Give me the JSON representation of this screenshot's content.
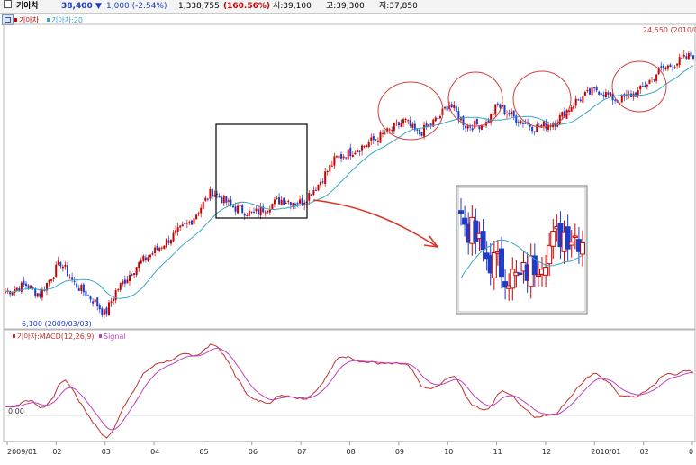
{
  "header": {
    "checkbox_icon": "checkbox-icon",
    "stock_name": "기아차",
    "price": "38,400",
    "change_arrow": "▼",
    "change": "1,000 (-2.54%)",
    "volume": "1,338,755",
    "volume_change": "(160.56%)",
    "open": "시:39,100",
    "high": "고:39,300",
    "low": "저:37,850",
    "colors": {
      "up": "#cc0000",
      "down": "#1e3cc8",
      "text": "#000000"
    }
  },
  "price_panel": {
    "legend_price": "기아차",
    "legend_ma": "기아차:20",
    "high_label": "24,550 (2010/0",
    "low_label": "6,100 (2009/03/03)",
    "settings_icon": "settings-icon",
    "annotation_arrow_color": "#e03020",
    "ma_color": "#39a6c8"
  },
  "macd_panel": {
    "legend_name": "기아차:MACD(12,26,9)",
    "legend_signal": "Signal",
    "zero_label": "0.00",
    "macd_color": "#c03030",
    "signal_color": "#c040c0"
  },
  "chart_data": [
    {
      "type": "candlestick",
      "series": [
        {
          "name": "기아차",
          "color_up": "#cc0000",
          "color_down": "#1e3cc8"
        },
        {
          "name": "기아차:20",
          "color": "#39a6c8"
        }
      ],
      "low_point": {
        "value": 6100,
        "date": "2009/03/03"
      },
      "high_point": {
        "value": 24550
      },
      "x_ticks": [
        "2009/01",
        "02",
        "03",
        "04",
        "05",
        "06",
        "07",
        "08",
        "09",
        "10",
        "11",
        "12",
        "2010/01",
        "02",
        "0"
      ],
      "path_anchors": [
        [
          0,
          7800
        ],
        [
          0.03,
          8300
        ],
        [
          0.05,
          7600
        ],
        [
          0.08,
          9900
        ],
        [
          0.1,
          8400
        ],
        [
          0.13,
          7100
        ],
        [
          0.145,
          6200
        ],
        [
          0.16,
          7800
        ],
        [
          0.19,
          9600
        ],
        [
          0.23,
          11200
        ],
        [
          0.27,
          12800
        ],
        [
          0.3,
          14900
        ],
        [
          0.33,
          13800
        ],
        [
          0.36,
          13300
        ],
        [
          0.4,
          14300
        ],
        [
          0.43,
          14100
        ],
        [
          0.455,
          15400
        ],
        [
          0.48,
          17200
        ],
        [
          0.52,
          18100
        ],
        [
          0.56,
          19200
        ],
        [
          0.58,
          19900
        ],
        [
          0.6,
          18900
        ],
        [
          0.63,
          20100
        ],
        [
          0.645,
          21100
        ],
        [
          0.67,
          19500
        ],
        [
          0.7,
          19700
        ],
        [
          0.715,
          21000
        ],
        [
          0.74,
          20100
        ],
        [
          0.77,
          19400
        ],
        [
          0.8,
          19800
        ],
        [
          0.83,
          21300
        ],
        [
          0.86,
          22100
        ],
        [
          0.89,
          21300
        ],
        [
          0.92,
          21900
        ],
        [
          0.95,
          23400
        ],
        [
          1.0,
          24550
        ]
      ]
    },
    {
      "type": "line",
      "series": [
        {
          "name": "기아차:MACD(12,26,9)",
          "color": "#c03030"
        },
        {
          "name": "Signal",
          "color": "#c040c0"
        }
      ],
      "zero_label": "0.00"
    }
  ]
}
